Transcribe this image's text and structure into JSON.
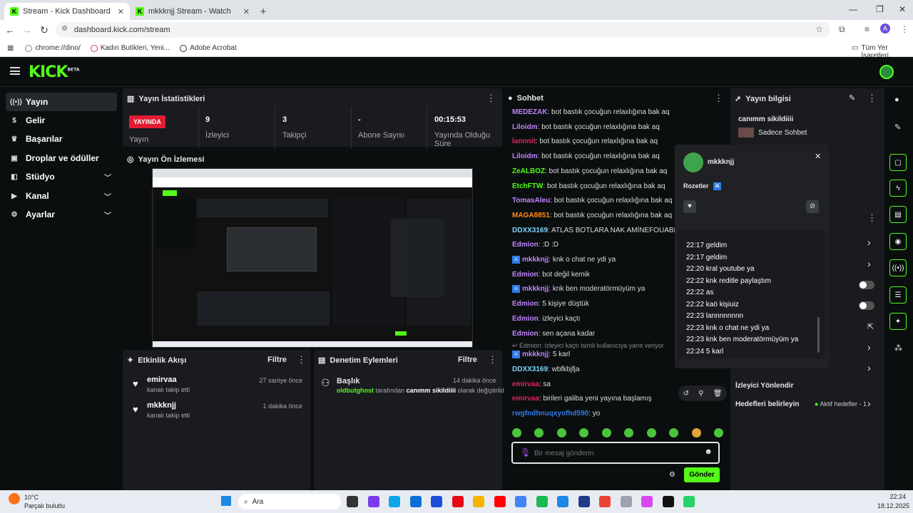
{
  "browser": {
    "tabs": [
      {
        "title": "Stream - Kick Dashboard",
        "active": true
      },
      {
        "title": "mkkknjj Stream - Watch Live on",
        "active": false
      }
    ],
    "url": "dashboard.kick.com/stream",
    "bookmarks": [
      "chrome://dino/",
      "Kadın Butikleri, Yeni...",
      "Adobe Acrobat"
    ],
    "all_bookmarks": "Tüm Yer İşaretleri"
  },
  "header": {
    "logo": "KICK",
    "beta": "BETA"
  },
  "sidebar": {
    "items": [
      {
        "label": "Yayın",
        "icon": "broadcast-icon",
        "active": true
      },
      {
        "label": "Gelir",
        "icon": "money-icon"
      },
      {
        "label": "Başarılar",
        "icon": "trophy-icon"
      },
      {
        "label": "Droplar ve ödüller",
        "icon": "gift-icon"
      },
      {
        "label": "Stüdyo",
        "icon": "studio-icon",
        "expandable": true
      },
      {
        "label": "Kanal",
        "icon": "channel-icon",
        "expandable": true
      },
      {
        "label": "Ayarlar",
        "icon": "gear-icon",
        "expandable": true
      }
    ]
  },
  "stats": {
    "title": "Yayın İstatistikleri",
    "live_badge": "YAYINDA",
    "status_label": "Yayın",
    "items": [
      {
        "value": "9",
        "label": "İzleyici"
      },
      {
        "value": "3",
        "label": "Takipçi"
      },
      {
        "value": "-",
        "label": "Abone Sayısı"
      },
      {
        "value": "00:15:53",
        "label": "Yayında Olduğu Süre"
      }
    ]
  },
  "preview": {
    "title": "Yayın Ön İzlemesi"
  },
  "activity": {
    "title": "Etkinlik Akışı",
    "filter": "Filtre",
    "events": [
      {
        "user": "emirvaa",
        "desc": "kanalı takip etti",
        "time": "27 saniye önce"
      },
      {
        "user": "mkkknjj",
        "desc": "kanalı takip etti",
        "time": "1 dakika önce"
      }
    ]
  },
  "moderation": {
    "title": "Denetim Eylemleri",
    "filter": "Filtre",
    "actions": [
      {
        "heading": "Başlık",
        "time": "14 dakika önce",
        "actor": "oldbutghost",
        "mid": "tarafından",
        "value": "canımm sikildiiii",
        "end": "olarak değiştirildi"
      }
    ]
  },
  "chat": {
    "title": "Sohbet",
    "messages": [
      {
        "user": "MEDEZAK",
        "color": "#c084fc",
        "text": "bot bastık çocuğun relaxlığına bak aq"
      },
      {
        "user": "Liloidm",
        "color": "#c084fc",
        "text": "bot bastık çocuğun relaxlığına bak aq"
      },
      {
        "user": "lannnit",
        "color": "#e0245e",
        "text": "bot bastık çocuğun relaxlığına bak aq"
      },
      {
        "user": "Liloidm",
        "color": "#c084fc",
        "text": "bot bastık çocuğun relaxlığına bak aq"
      },
      {
        "user": "ZeALBOZ",
        "color": "#53fc18",
        "text": "bot bastık çocuğun relaxlığına bak aq"
      },
      {
        "user": "EtchFTW",
        "color": "#53fc18",
        "text": "bot bastık çocuğun relaxlığına bak aq"
      },
      {
        "user": "TomasAleu",
        "color": "#c084fc",
        "text": "bot bastık çocuğun relaxlığına bak aq"
      },
      {
        "user": "MAGA8851",
        "color": "#ff8c1a",
        "text": "bot bastık çocuğun relaxlığına bak aq"
      },
      {
        "user": "DDXX3169",
        "color": "#7dd3fc",
        "text": "ATLAS BOTLARA NAK AMİNEFOUABNUC"
      },
      {
        "user": "Edmion",
        "color": "#c084fc",
        "text": ":D :D"
      },
      {
        "user": "mkkknjj",
        "color": "#c084fc",
        "text": "knk o chat ne ydi ya",
        "mod": true
      },
      {
        "user": "Edmion",
        "color": "#c084fc",
        "text": "bot değil kemik"
      },
      {
        "user": "mkkknjj",
        "color": "#c084fc",
        "text": "knk ben moderatörmüyüm ya",
        "mod": true
      },
      {
        "user": "Edmion",
        "color": "#c084fc",
        "text": "5 kişiye düştük"
      },
      {
        "user": "Edmion",
        "color": "#c084fc",
        "text": "izleyici kaçtı"
      },
      {
        "user": "Edmion",
        "color": "#c084fc",
        "text": "sen açana kadar"
      }
    ],
    "reply_note": "Edmion: izleyici kaçtı isimli kullanıcıya yanıt veriyor",
    "messages2": [
      {
        "user": "mkkknjj",
        "color": "#c084fc",
        "text": "5 karl",
        "mod": true
      },
      {
        "user": "DDXX3169",
        "color": "#7dd3fc",
        "text": "wbfkbjfja"
      },
      {
        "user": "emirvaa",
        "color": "#e0245e",
        "text": "sa"
      },
      {
        "user": "emirvaa",
        "color": "#e0245e",
        "text": "birileri galiba yeni yayına başlamış"
      },
      {
        "user": "rwgfndhnuqxyofhd590",
        "color": "#2d7be5",
        "text": "yo"
      }
    ],
    "input_placeholder": "Bir mesaj gönderin",
    "send_label": "Gönder"
  },
  "stream_info": {
    "title": "Yayın bilgisi",
    "stream_title": "canımm sikildiiii",
    "category": "Sadece Sohbet",
    "viewer_redirect": "İzleyici Yönlendir",
    "goals_label": "Hedefleri belirleyin",
    "goals_status": "Aktif hedefler - 1"
  },
  "user_popup": {
    "username": "mkkknjj",
    "badges_label": "Rozetler",
    "history": [
      "22:17 geldim",
      "22:17 geldim",
      "22:20 kral youtube ya",
      "22:22 knk reditle paylaştım",
      "22:22 as",
      "22:22 kaö kişiuiz",
      "22:23 lannnnnnnn",
      "22:23 knk o chat ne ydi ya",
      "22:23 knk ben moderatörmüyüm ya",
      "22:24 5 karl"
    ]
  },
  "taskbar": {
    "weather_temp": "10°C",
    "weather_desc": "Parçalı bulutlu",
    "search": "Ara",
    "time": "22:24",
    "date": "18.12.2025"
  }
}
